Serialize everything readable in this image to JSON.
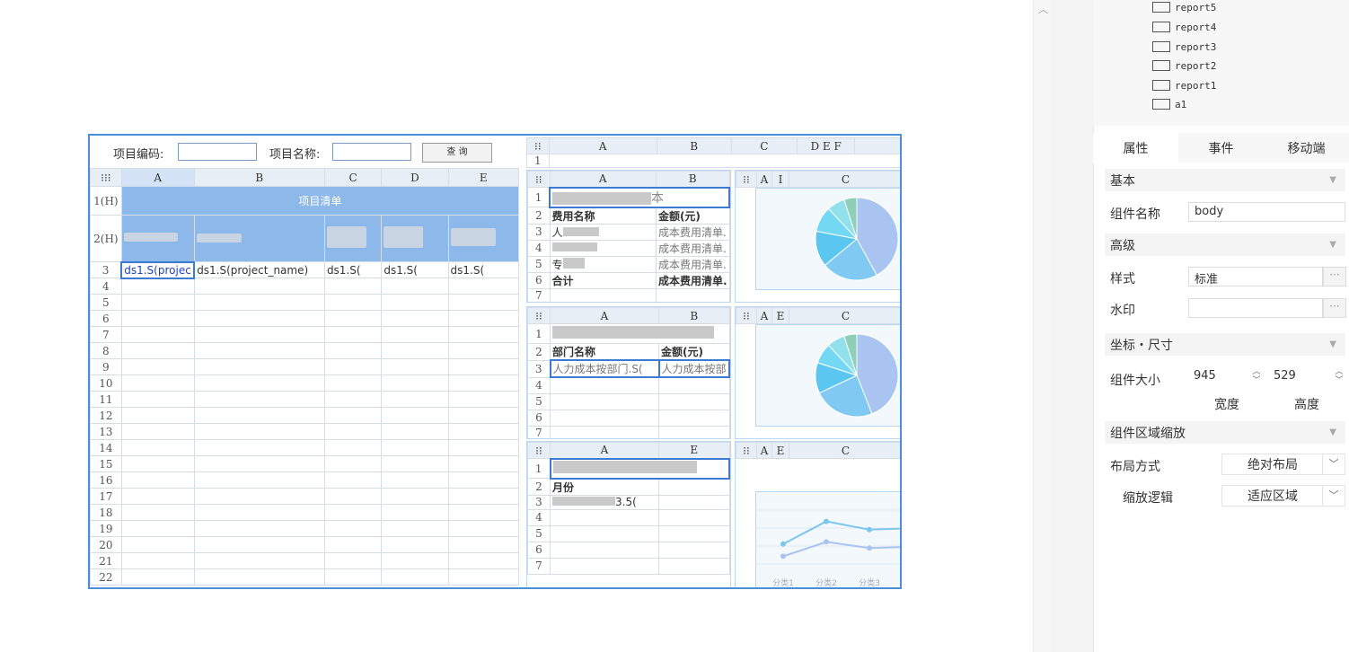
{
  "tree": {
    "items": [
      "report5",
      "report4",
      "report3",
      "report2",
      "report1",
      "a1"
    ]
  },
  "tabs": [
    "属性",
    "事件",
    "移动端"
  ],
  "panel": {
    "basic": "基本",
    "name_label": "组件名称",
    "name_value": "body",
    "advanced": "高级",
    "style_label": "样式",
    "style_value": "标准",
    "watermark_label": "水印",
    "coord": "坐标・尺寸",
    "size_label": "组件大小",
    "width_value": "945",
    "height_value": "529",
    "width_caption": "宽度",
    "height_caption": "高度",
    "zoom_section": "组件区域缩放",
    "layout_label": "布局方式",
    "layout_value": "绝对布局",
    "zoom_label": "缩放逻辑",
    "zoom_value": "适应区域",
    "ellipsis": "···"
  },
  "report": {
    "param_code": "项目编码:",
    "param_name": "项目名称:",
    "query_btn": "查 询",
    "main_cols": [
      "A",
      "B",
      "C",
      "D",
      "E"
    ],
    "main_title": "项目清单",
    "row_h1": "1(H)",
    "row_h2": "2(H)",
    "row3": [
      "ds1.S(projec",
      "ds1.S(project_name)",
      "ds1.S(",
      "ds1.S(",
      "ds1.S("
    ],
    "row_nums": [
      "3",
      "4",
      "5",
      "6",
      "7",
      "8",
      "9",
      "10",
      "11",
      "12",
      "13",
      "14",
      "15",
      "16",
      "17",
      "18",
      "19",
      "20",
      "21",
      "22"
    ],
    "top_strip_cols": [
      "A",
      "B",
      "C",
      "D E F"
    ],
    "t1_title": "本",
    "t1_rows": [
      [
        "费用名称",
        "金额(元)"
      ],
      [
        "人",
        "成本费用清单."
      ],
      [
        "",
        "成本费用清单."
      ],
      [
        "专",
        "成本费用清单."
      ],
      [
        "合计",
        "成本费用清单."
      ]
    ],
    "t2_rows": [
      [
        "部门名称",
        "金额(元)"
      ],
      [
        "人力成本按部门.S(",
        "人力成本按部"
      ]
    ],
    "t3_rows": [
      [
        "月份",
        ""
      ],
      [
        "人力成本",
        "3.5("
      ]
    ],
    "mini_cols_ab": [
      "A",
      "B"
    ],
    "mini_cols_ae": [
      "A",
      "E"
    ],
    "mini_cols_chart": [
      "A",
      "I",
      "C"
    ],
    "line_x": [
      "分类1",
      "分类2",
      "分类3"
    ]
  },
  "chart_data": [
    {
      "type": "pie",
      "values": [
        42,
        22,
        14,
        10,
        7,
        5
      ],
      "colors": [
        "#a9c4f0",
        "#7fc9f2",
        "#5bc7f0",
        "#73d8f4",
        "#92e0ec",
        "#8fcfb8"
      ]
    },
    {
      "type": "pie",
      "values": [
        44,
        24,
        12,
        8,
        7,
        5
      ],
      "colors": [
        "#a9c4f0",
        "#7fc9f2",
        "#5bc7f0",
        "#73d8f4",
        "#92e0ec",
        "#8fcfb8"
      ]
    },
    {
      "type": "line",
      "categories": [
        "分类1",
        "分类2",
        "分类3"
      ],
      "series": [
        {
          "values": [
            3,
            5.2,
            4.4
          ]
        },
        {
          "values": [
            1.8,
            3.2,
            2.6
          ]
        }
      ],
      "colors": [
        "#7cc6f0",
        "#a9c4f0"
      ]
    }
  ]
}
